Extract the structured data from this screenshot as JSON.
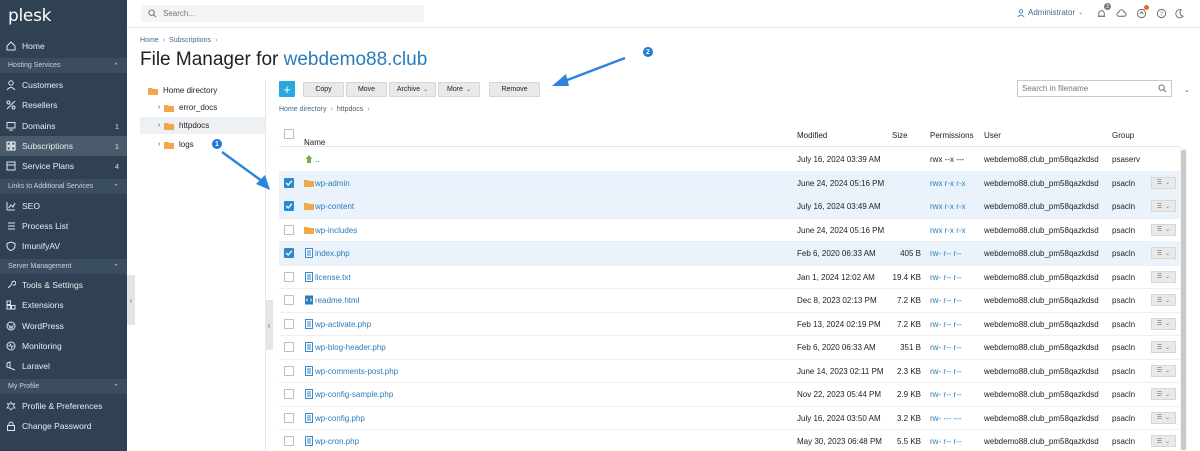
{
  "app": {
    "logo": "plesk"
  },
  "sidebar": {
    "items": [
      {
        "label": "Home",
        "icon": "home-icon"
      },
      {
        "section": "Hosting Services"
      },
      {
        "label": "Customers",
        "icon": "user-icon"
      },
      {
        "label": "Resellers",
        "icon": "percent-icon"
      },
      {
        "label": "Domains",
        "icon": "monitor-icon",
        "count": "1"
      },
      {
        "label": "Subscriptions",
        "icon": "grid-icon",
        "count": "1",
        "active": true
      },
      {
        "label": "Service Plans",
        "icon": "plans-icon",
        "count": "4"
      },
      {
        "section": "Links to Additional Services"
      },
      {
        "label": "SEO",
        "icon": "seo-icon"
      },
      {
        "label": "Process List",
        "icon": "list-icon"
      },
      {
        "label": "ImunifyAV",
        "icon": "shield-icon"
      },
      {
        "section": "Server Management"
      },
      {
        "label": "Tools & Settings",
        "icon": "tools-icon"
      },
      {
        "label": "Extensions",
        "icon": "extensions-icon"
      },
      {
        "label": "WordPress",
        "icon": "wordpress-icon"
      },
      {
        "label": "Monitoring",
        "icon": "monitoring-icon"
      },
      {
        "label": "Laravel",
        "icon": "laravel-icon"
      },
      {
        "section": "My Profile"
      },
      {
        "label": "Profile & Preferences",
        "icon": "profile-icon"
      },
      {
        "label": "Change Password",
        "icon": "lock-icon"
      }
    ]
  },
  "header": {
    "search_placeholder": "Search...",
    "user": "Administrator",
    "notification_count": "3"
  },
  "breadcrumb": [
    "Home",
    "Subscriptions"
  ],
  "title": {
    "prefix": "File Manager for ",
    "domain": "webdemo88.club"
  },
  "tree": {
    "root": "Home directory",
    "items": [
      "error_docs",
      "httpdocs",
      "logs"
    ]
  },
  "toolbar": {
    "copy": "Copy",
    "move": "Move",
    "archive": "Archive",
    "more": "More",
    "remove": "Remove",
    "file_search_placeholder": "Search in filename"
  },
  "path": {
    "root": "Home directory",
    "current": "httpdocs"
  },
  "table": {
    "headers": {
      "name": "Name",
      "modified": "Modified",
      "size": "Size",
      "permissions": "Permissions",
      "user": "User",
      "group": "Group"
    },
    "rows": [
      {
        "name": "..",
        "type": "up",
        "modified": "July 16, 2024 03:39 AM",
        "size": "",
        "perm": "rwx --x ---",
        "user": "webdemo88.club_pm58qazkdsd",
        "group": "psaserv",
        "checked": false
      },
      {
        "name": "wp-admin",
        "type": "folder",
        "modified": "June 24, 2024 05:16 PM",
        "size": "",
        "perm": "rwx r-x r-x",
        "user": "webdemo88.club_pm58qazkdsd",
        "group": "psacln",
        "checked": true
      },
      {
        "name": "wp-content",
        "type": "folder",
        "modified": "July 16, 2024 03:49 AM",
        "size": "",
        "perm": "rwx r-x r-x",
        "user": "webdemo88.club_pm58qazkdsd",
        "group": "psacln",
        "checked": true
      },
      {
        "name": "wp-includes",
        "type": "folder",
        "modified": "June 24, 2024 05:16 PM",
        "size": "",
        "perm": "rwx r-x r-x",
        "user": "webdemo88.club_pm58qazkdsd",
        "group": "psacln",
        "checked": false
      },
      {
        "name": "index.php",
        "type": "file",
        "modified": "Feb 6, 2020 06:33 AM",
        "size": "405 B",
        "perm": "rw- r-- r--",
        "user": "webdemo88.club_pm58qazkdsd",
        "group": "psacln",
        "checked": true
      },
      {
        "name": "license.txt",
        "type": "file",
        "modified": "Jan 1, 2024 12:02 AM",
        "size": "19.4 KB",
        "perm": "rw- r-- r--",
        "user": "webdemo88.club_pm58qazkdsd",
        "group": "psacln",
        "checked": false
      },
      {
        "name": "readme.html",
        "type": "html",
        "modified": "Dec 8, 2023 02:13 PM",
        "size": "7.2 KB",
        "perm": "rw- r-- r--",
        "user": "webdemo88.club_pm58qazkdsd",
        "group": "psacln",
        "checked": false
      },
      {
        "name": "wp-activate.php",
        "type": "file",
        "modified": "Feb 13, 2024 02:19 PM",
        "size": "7.2 KB",
        "perm": "rw- r-- r--",
        "user": "webdemo88.club_pm58qazkdsd",
        "group": "psacln",
        "checked": false
      },
      {
        "name": "wp-blog-header.php",
        "type": "file",
        "modified": "Feb 6, 2020 06:33 AM",
        "size": "351 B",
        "perm": "rw- r-- r--",
        "user": "webdemo88.club_pm58qazkdsd",
        "group": "psacln",
        "checked": false
      },
      {
        "name": "wp-comments-post.php",
        "type": "file",
        "modified": "June 14, 2023 02:11 PM",
        "size": "2.3 KB",
        "perm": "rw- r-- r--",
        "user": "webdemo88.club_pm58qazkdsd",
        "group": "psacln",
        "checked": false
      },
      {
        "name": "wp-config-sample.php",
        "type": "file",
        "modified": "Nov 22, 2023 05:44 PM",
        "size": "2.9 KB",
        "perm": "rw- r-- r--",
        "user": "webdemo88.club_pm58qazkdsd",
        "group": "psacln",
        "checked": false
      },
      {
        "name": "wp-config.php",
        "type": "file",
        "modified": "July 16, 2024 03:50 AM",
        "size": "3.2 KB",
        "perm": "rw- --- ---",
        "user": "webdemo88.club_pm58qazkdsd",
        "group": "psacln",
        "checked": false
      },
      {
        "name": "wp-cron.php",
        "type": "file",
        "modified": "May 30, 2023 06:48 PM",
        "size": "5.5 KB",
        "perm": "rw- r-- r--",
        "user": "webdemo88.club_pm58qazkdsd",
        "group": "psacln",
        "checked": false
      }
    ]
  },
  "annotations": {
    "marker1": "1",
    "marker2": "2"
  },
  "colors": {
    "sidebar": "#2f4152",
    "accent": "#28a7e0",
    "link": "#2a7cbb",
    "marker": "#1e7ad6",
    "folder": "#f0a84a"
  }
}
